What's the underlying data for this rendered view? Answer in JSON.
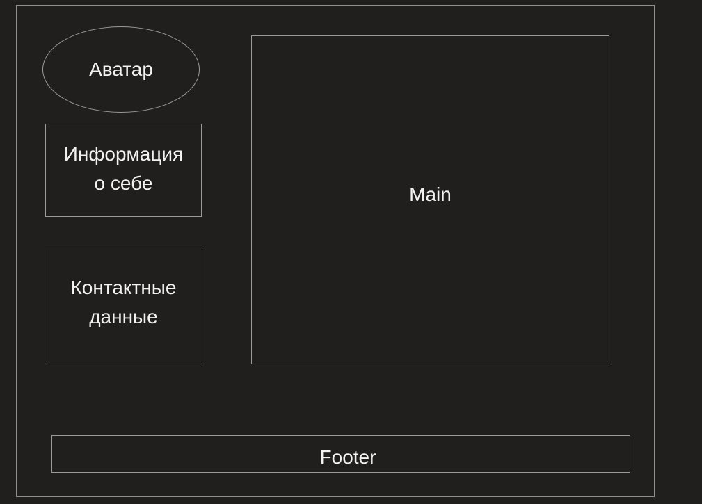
{
  "diagram": {
    "avatar_label": "Аватар",
    "about_label": "Информация\nо себе",
    "contacts_label": "Контактные\nданные",
    "main_label": "Main",
    "footer_label": "Footer"
  },
  "colors": {
    "background": "#201f1d",
    "border": "#9a9a9a",
    "text": "#f2f2f2"
  }
}
